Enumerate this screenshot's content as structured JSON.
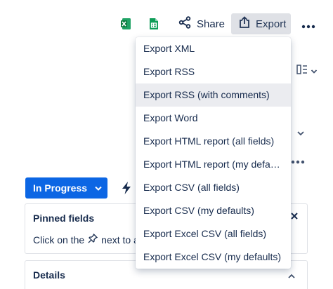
{
  "toolbar": {
    "excel_icon": "excel-icon",
    "sheets_icon": "google-sheets-icon",
    "share_label": "Share",
    "export_label": "Export",
    "more_icon": "more-horizontal-icon"
  },
  "export_menu": {
    "items": [
      "Export XML",
      "Export RSS",
      "Export RSS (with comments)",
      "Export Word",
      "Export HTML report (all fields)",
      "Export HTML report (my defaults)",
      "Export CSV (all fields)",
      "Export CSV (my defaults)",
      "Export Excel CSV (all fields)",
      "Export Excel CSV (my defaults)"
    ],
    "highlighted_index": 2
  },
  "status": {
    "label": "In Progress"
  },
  "pinned_fields": {
    "title": "Pinned fields",
    "text_before": "Click on the",
    "text_after": "next to a"
  },
  "details": {
    "title": "Details"
  },
  "colors": {
    "accent": "#0c66e4",
    "export_bg": "#dfe1e6",
    "menu_hover": "#ebecf0",
    "excel_green": "#1d6f42",
    "sheets_green": "#0f9d58"
  }
}
